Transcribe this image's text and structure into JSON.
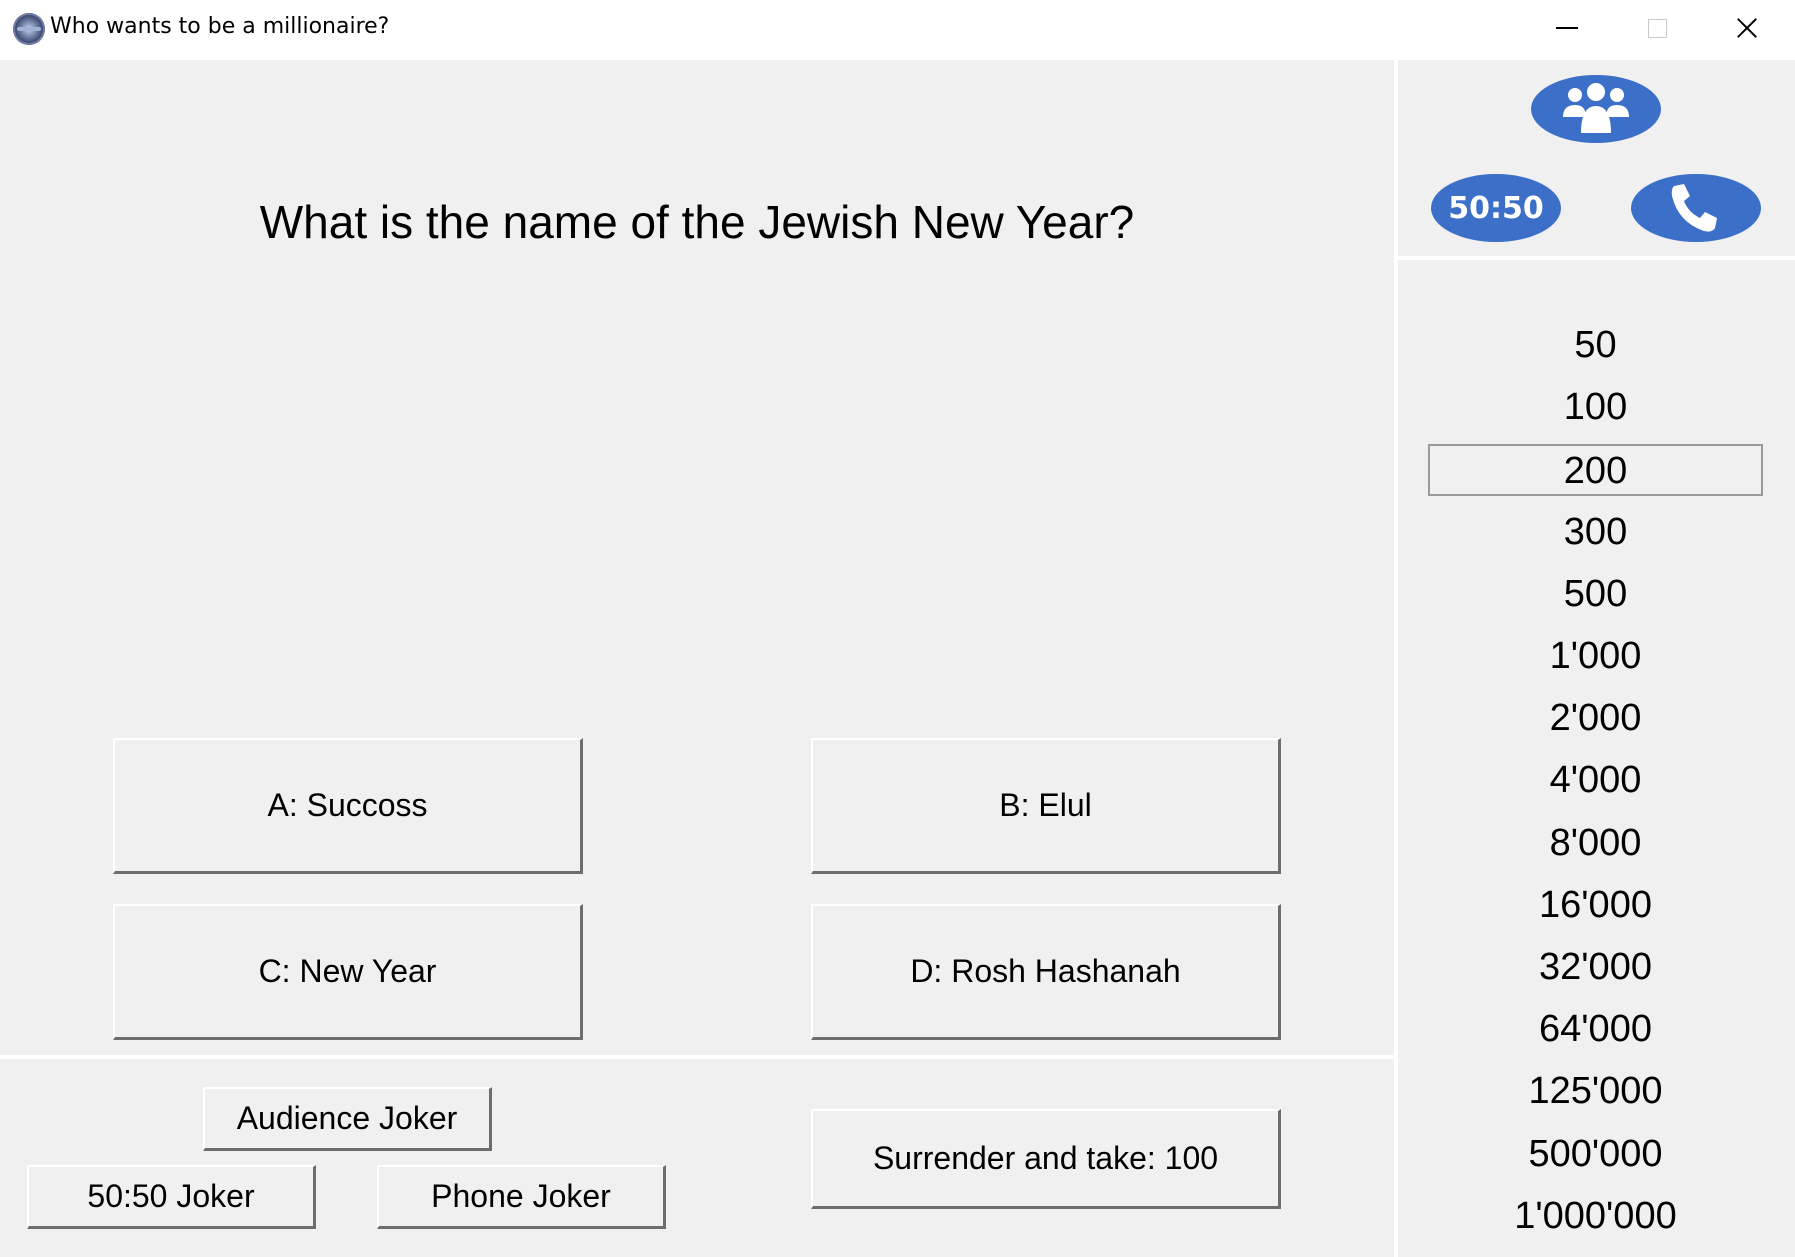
{
  "window": {
    "title": "Who wants to be a millionaire?"
  },
  "question": {
    "text": "What is the name of the Jewish New Year?"
  },
  "answers": {
    "a": "A: Succoss",
    "b": "B: Elul",
    "c": "C: New Year",
    "d": "D: Rosh Hashanah"
  },
  "jokers": {
    "audience_label": "Audience Joker",
    "fifty_label": "50:50 Joker",
    "phone_label": "Phone Joker"
  },
  "surrender": {
    "label": "Surrender and take: 100"
  },
  "lifeline_icons": {
    "audience_icon": "people-group-icon",
    "fifty_text": "50:50",
    "phone_icon": "phone-icon",
    "color": "#3b6fc8"
  },
  "ladder": {
    "levels": [
      "50",
      "100",
      "200",
      "300",
      "500",
      "1'000",
      "2'000",
      "4'000",
      "8'000",
      "16'000",
      "32'000",
      "64'000",
      "125'000",
      "500'000",
      "1'000'000"
    ],
    "current_level": "200"
  }
}
